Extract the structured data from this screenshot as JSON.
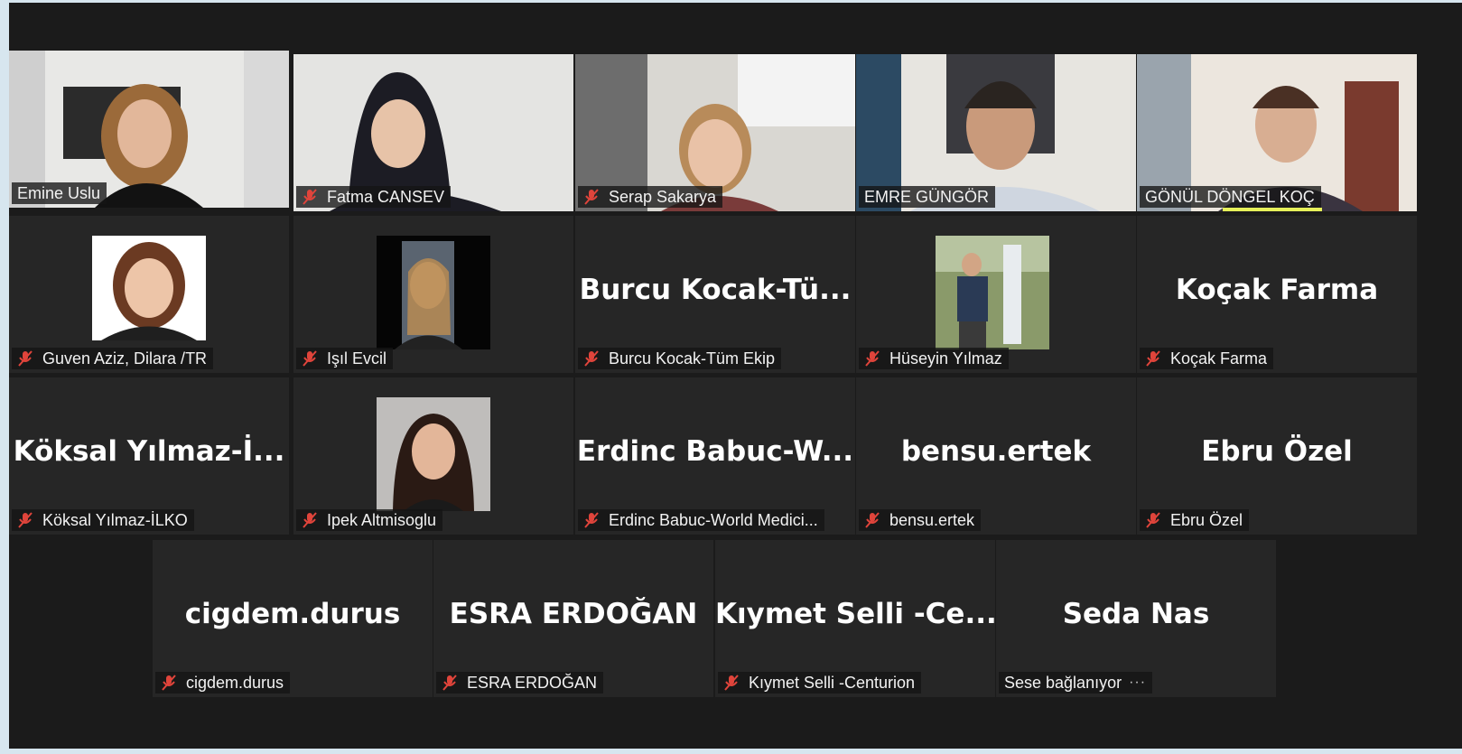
{
  "participants": [
    {
      "name": "Emine Uslu",
      "display": "",
      "muted": false,
      "speaking": true
    },
    {
      "name": "Fatma CANSEV",
      "display": "",
      "muted": true
    },
    {
      "name": "Serap Sakarya",
      "display": "",
      "muted": true
    },
    {
      "name": "EMRE GÜNGÖR",
      "display": "",
      "muted": false
    },
    {
      "name": "GÖNÜL DÖNGEL KOÇ",
      "display": "",
      "muted": false
    },
    {
      "name": "Guven Aziz, Dilara /TR",
      "display": "",
      "muted": true
    },
    {
      "name": "Işıl Evcil",
      "display": "",
      "muted": true
    },
    {
      "name": "Burcu Kocak-Tüm Ekip",
      "display": "Burcu  Kocak-Tü...",
      "muted": true
    },
    {
      "name": "Hüseyin Yılmaz",
      "display": "",
      "muted": true
    },
    {
      "name": "Koçak Farma",
      "display": "Koçak Farma",
      "muted": true
    },
    {
      "name": "Köksal Yılmaz-İLKO",
      "display": "Köksal  Yılmaz-İ...",
      "muted": true
    },
    {
      "name": "Ipek Altmisoglu",
      "display": "",
      "muted": true
    },
    {
      "name": "Erdinc Babuc-World Medici...",
      "display": "Erdinc  Babuc-W...",
      "muted": true
    },
    {
      "name": "bensu.ertek",
      "display": "bensu.ertek",
      "muted": true
    },
    {
      "name": "Ebru Özel",
      "display": "Ebru Özel",
      "muted": true
    },
    {
      "name": "cigdem.durus",
      "display": "cigdem.durus",
      "muted": true
    },
    {
      "name": "ESRA ERDOĞAN",
      "display": "ESRA ERDOĞAN",
      "muted": true
    },
    {
      "name": "Kıymet Selli -Centurion",
      "display": "Kıymet  Selli  -Ce...",
      "muted": true
    },
    {
      "name": "Sese bağlanıyor",
      "display": "Seda Nas",
      "muted": false,
      "connecting": true,
      "dots": "···"
    }
  ],
  "colors": {
    "speaking": "#e6f05a",
    "mute_icon": "#e0443b",
    "tile": "#262626"
  }
}
